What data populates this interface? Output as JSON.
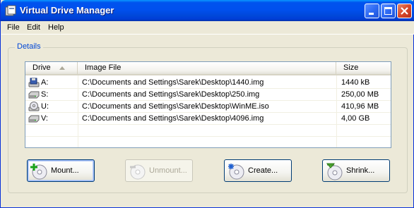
{
  "window": {
    "title": "Virtual Drive Manager",
    "minimize_icon": "minimize-icon",
    "maximize_icon": "maximize-icon",
    "close_icon": "close-icon"
  },
  "menu": {
    "items": [
      "File",
      "Edit",
      "Help"
    ]
  },
  "details": {
    "legend": "Details",
    "columns": [
      "Drive",
      "Image File",
      "Size"
    ],
    "sort_column": "Drive",
    "sort_direction": "ascending",
    "rows": [
      {
        "drive": "A:",
        "icon": "floppy-drive-icon",
        "image": "C:\\Documents and Settings\\Sarek\\Desktop\\1440.img",
        "size": "1440 kB"
      },
      {
        "drive": "S:",
        "icon": "hard-drive-icon",
        "image": "C:\\Documents and Settings\\Sarek\\Desktop\\250.img",
        "size": "250,00 MB"
      },
      {
        "drive": "U:",
        "icon": "cd-drive-icon",
        "image": "C:\\Documents and Settings\\Sarek\\Desktop\\WinME.iso",
        "size": "410,96 MB"
      },
      {
        "drive": "V:",
        "icon": "hard-drive-icon",
        "image": "C:\\Documents and Settings\\Sarek\\Desktop\\4096.img",
        "size": "4,00 GB"
      }
    ]
  },
  "buttons": {
    "mount": {
      "label": "Mount...",
      "icon": "mount-disc-icon",
      "enabled": true
    },
    "unmount": {
      "label": "Unmount...",
      "icon": "unmount-disc-icon",
      "enabled": false
    },
    "create": {
      "label": "Create...",
      "icon": "create-disc-icon",
      "enabled": true
    },
    "shrink": {
      "label": "Shrink...",
      "icon": "shrink-disc-icon",
      "enabled": true
    }
  },
  "colors": {
    "titlebar": "#0053EE",
    "accent_text": "#0046D5",
    "window_bg": "#ECE9D8"
  }
}
